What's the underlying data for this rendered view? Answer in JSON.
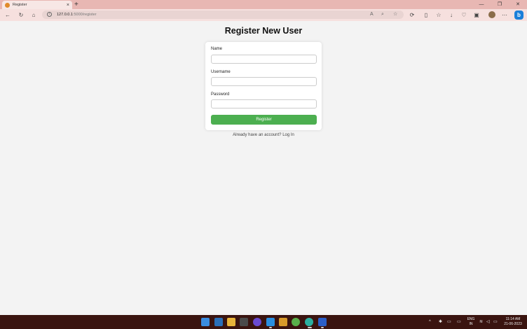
{
  "browser": {
    "tab_title": "Register",
    "tab_close": "×",
    "new_tab": "+",
    "url_host": "127.0.0.1",
    "url_rest": ":5000/register",
    "window_minimize": "—",
    "window_restore": "❐",
    "window_close": "✕"
  },
  "page": {
    "title": "Register New User",
    "name_label": "Name",
    "name_value": "",
    "username_label": "Username",
    "username_value": "",
    "password_label": "Password",
    "password_value": "",
    "submit_label": "Register",
    "login_prompt": "Already have an account? ",
    "login_link": "Log In"
  },
  "taskbar": {
    "lang_top": "ENG",
    "lang_bottom": "IN",
    "time": "11:14 AM",
    "date": "21-06-2023"
  },
  "colors": {
    "tab_strip": "#e8b7b3",
    "toolbar": "#f6e0de",
    "submit_button": "#4caf50",
    "page_background": "#f3f3f3",
    "taskbar": "#3a1410"
  }
}
